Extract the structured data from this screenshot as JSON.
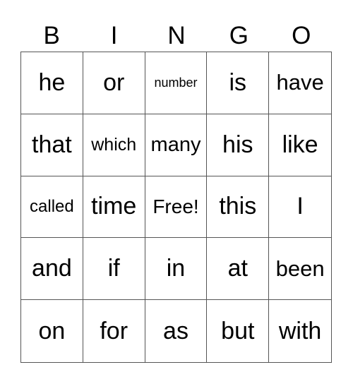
{
  "header": [
    "B",
    "I",
    "N",
    "G",
    "O"
  ],
  "cells": [
    "he",
    "or",
    "number",
    "is",
    "have",
    "that",
    "which",
    "many",
    "his",
    "like",
    "called",
    "time",
    "Free!",
    "this",
    "I",
    "and",
    "if",
    "in",
    "at",
    "been",
    "on",
    "for",
    "as",
    "but",
    "with"
  ]
}
